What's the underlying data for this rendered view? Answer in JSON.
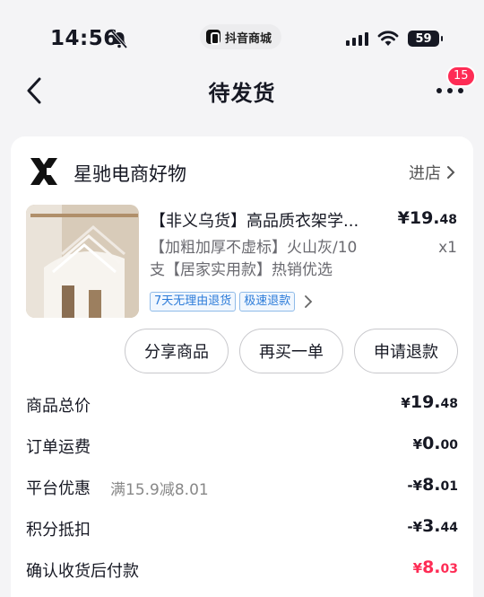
{
  "status_bar": {
    "time": "14:56",
    "app_name": "抖音商城",
    "battery": "59"
  },
  "nav": {
    "title": "待发货",
    "badge_count": "15"
  },
  "shop": {
    "name": "星驰电商好物",
    "enter_label": "进店"
  },
  "product": {
    "title": "【非义乌货】高品质衣架学...",
    "price_int": "¥19.",
    "price_dec": "48",
    "spec_line1": "【加粗加厚不虚标】火山灰/10",
    "spec_line2": "支【居家实用款】热销优选",
    "quantity": "x1",
    "tags": [
      "7天无理由退货",
      "极速退款"
    ]
  },
  "actions": {
    "share": "分享商品",
    "rebuy": "再买一单",
    "refund": "申请退款"
  },
  "fees": {
    "total": {
      "label": "商品总价",
      "cur": "¥",
      "int": "19.",
      "dec": "48"
    },
    "shipping": {
      "label": "订单运费",
      "cur": "¥",
      "int": "0.",
      "dec": "00"
    },
    "discount": {
      "label": "平台优惠",
      "note": "满15.9减8.01",
      "cur": "-¥",
      "int": "8.",
      "dec": "01"
    },
    "points": {
      "label": "积分抵扣",
      "cur": "-¥",
      "int": "3.",
      "dec": "44"
    },
    "pay_after": {
      "label": "确认收货后付款",
      "cur": "¥",
      "int": "8.",
      "dec": "03"
    }
  },
  "colors": {
    "accent": "#fe2c55",
    "tag_blue": "#2b7bd9",
    "background": "#f4f4f6"
  }
}
